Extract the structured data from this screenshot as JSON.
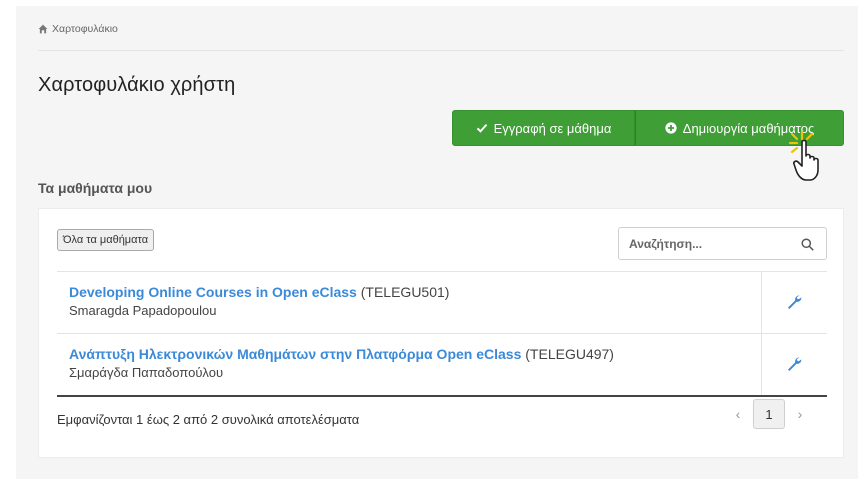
{
  "breadcrumb": {
    "home_label": "Χαρτοφυλάκιο"
  },
  "page": {
    "title": "Χαρτοφυλάκιο χρήστη"
  },
  "actions": {
    "register_label": "Εγγραφή σε μάθημα",
    "create_label": "Δημιουργία μαθήματος"
  },
  "section": {
    "title": "Τα μαθήματα μου"
  },
  "filter": {
    "label": "Όλα τα μαθήματα"
  },
  "search": {
    "placeholder": "Αναζήτηση..."
  },
  "courses": [
    {
      "title": "Developing Online Courses in Open eClass",
      "code": "(TELEGU501)",
      "professor": "Smaragda Papadopoulou"
    },
    {
      "title": "Ανάπτυξη Ηλεκτρονικών Μαθημάτων στην Πλατφόρμα Open eClass",
      "code": "(TELEGU497)",
      "professor": "Σμαράγδα Παπαδοπούλου"
    }
  ],
  "pagination": {
    "summary": "Εμφανίζονται 1 έως 2 από 2 συνολικά αποτελέσματα",
    "prev": "‹",
    "current": "1",
    "next": "›"
  },
  "colors": {
    "primary_green": "#3f9e36",
    "link_blue": "#3b8ad9",
    "background": "#f5f5f5"
  }
}
